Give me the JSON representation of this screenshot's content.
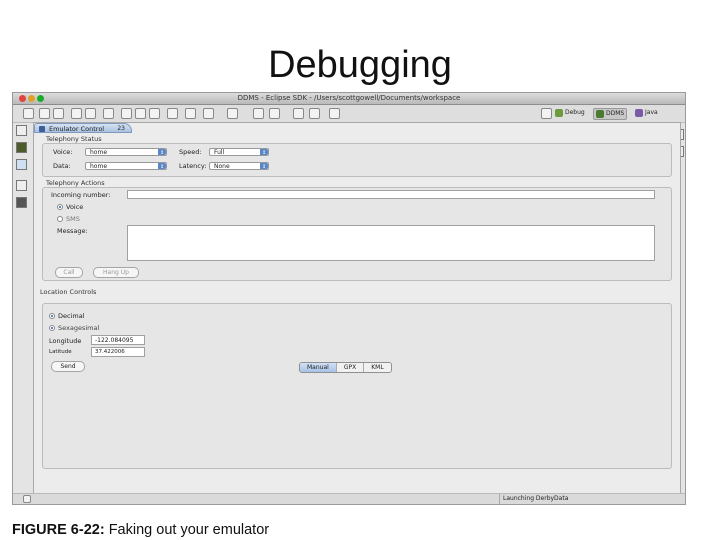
{
  "slide": {
    "title": "Debugging"
  },
  "window": {
    "title": "DDMS - Eclipse SDK - /Users/scottgowell/Documents/workspace",
    "perspectives": [
      {
        "label": "Debug",
        "color": "#6b9b3a"
      },
      {
        "label": "DDMS",
        "color": "#4a7b2e"
      },
      {
        "label": "Java",
        "color": "#7b5aa6"
      }
    ],
    "active_perspective": "DDMS"
  },
  "view": {
    "tab_label": "Emulator Control",
    "tab_close": "23"
  },
  "telephony_status": {
    "group_label": "Telephony Status",
    "voice_label": "Voice:",
    "voice_value": "home",
    "speed_label": "Speed:",
    "speed_value": "Full",
    "data_label": "Data:",
    "data_value": "home",
    "latency_label": "Latency:",
    "latency_value": "None"
  },
  "telephony_actions": {
    "group_label": "Telephony Actions",
    "incoming_label": "Incoming number:",
    "incoming_value": "",
    "voice_radio": "Voice",
    "sms_radio": "SMS",
    "message_label": "Message:",
    "call_button": "Call",
    "hangup_button": "Hang Up"
  },
  "location": {
    "group_label": "Location Controls",
    "tabs": [
      "Manual",
      "GPX",
      "KML"
    ],
    "active_tab": "Manual",
    "decimal_radio": "Decimal",
    "sexagesimal_radio": "Sexagesimal",
    "longitude_label": "Longitude",
    "longitude_value": "-122.084095",
    "latitude_label": "Latitude",
    "latitude_value": "37.422006",
    "send_button": "Send"
  },
  "status_bar": {
    "text": "Launching DerbyData"
  },
  "caption": {
    "figure": "FIGURE 6-22:",
    "text": "Faking out your emulator"
  }
}
